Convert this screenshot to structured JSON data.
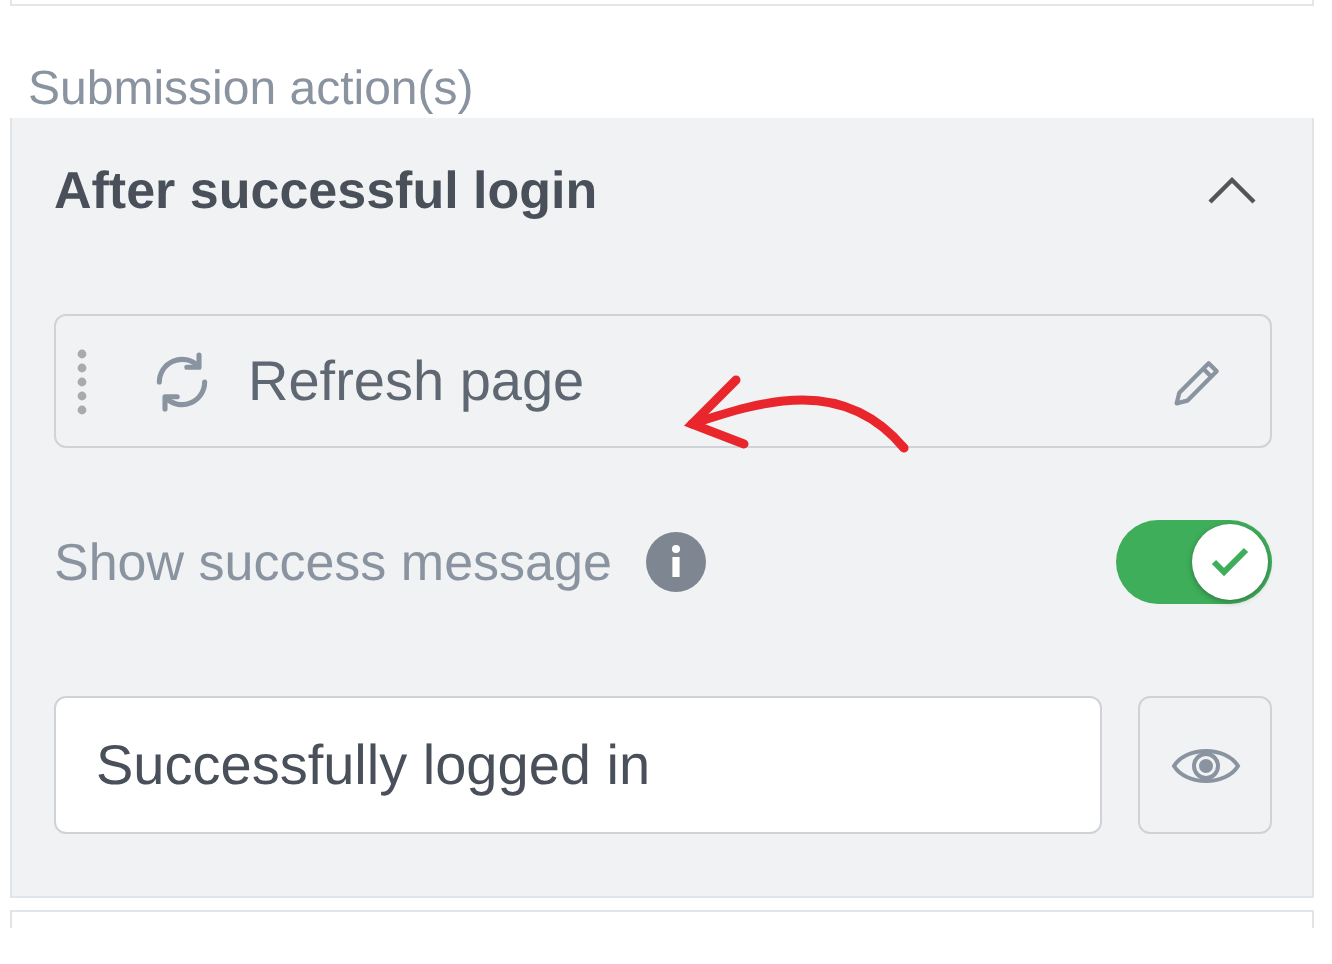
{
  "section_title": "Submission action(s)",
  "panel": {
    "title": "After successful login",
    "expanded": true,
    "actions": [
      {
        "label": "Refresh page"
      }
    ],
    "success_message": {
      "label": "Show success message",
      "on": true,
      "value": "Successfully logged in"
    }
  }
}
